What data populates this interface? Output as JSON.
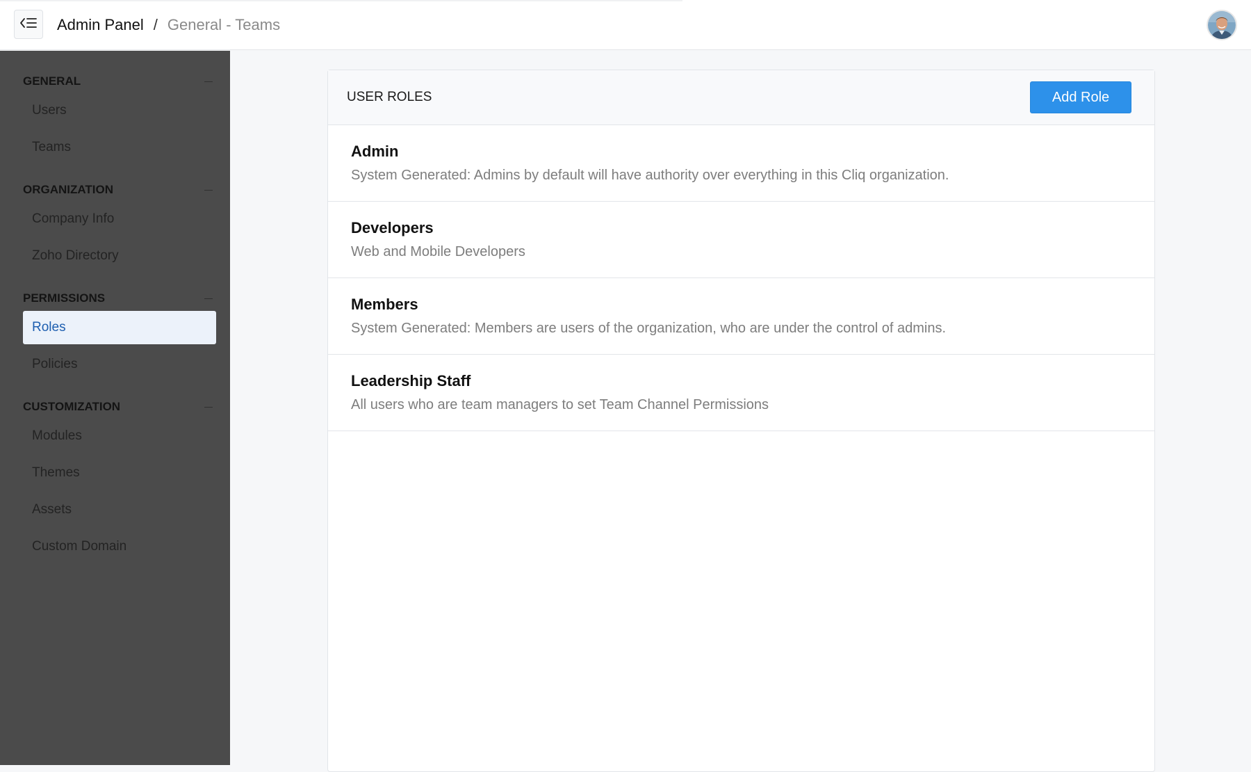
{
  "header": {
    "breadcrumb_root": "Admin Panel",
    "breadcrumb_separator": "/",
    "breadcrumb_current": "General - Teams",
    "toggle_icon": "collapse-menu-icon",
    "avatar_icon": "user-avatar"
  },
  "sidebar": {
    "sections": [
      {
        "title": "GENERAL",
        "items": [
          "Users",
          "Teams"
        ]
      },
      {
        "title": "ORGANIZATION",
        "items": [
          "Company Info",
          "Zoho Directory"
        ]
      },
      {
        "title": "PERMISSIONS",
        "items": [
          "Roles",
          "Policies"
        ]
      },
      {
        "title": "CUSTOMIZATION",
        "items": [
          "Modules",
          "Themes",
          "Assets",
          "Custom Domain"
        ]
      }
    ],
    "active_item": "Roles"
  },
  "panel": {
    "title": "USER ROLES",
    "add_button_label": "Add Role",
    "roles": [
      {
        "name": "Admin",
        "description": "System Generated: Admins by default will have authority over everything in this Cliq organization."
      },
      {
        "name": "Developers",
        "description": "Web and Mobile Developers"
      },
      {
        "name": "Members",
        "description": "System Generated: Members are users of the organization, who are under the control of admins."
      },
      {
        "name": "Leadership Staff",
        "description": "All users who are team managers to set Team Channel Permissions"
      }
    ]
  },
  "colors": {
    "sidebar_bg": "#4b4b4b",
    "active_item_bg": "#ecf2fa",
    "active_item_text": "#1e5fb0",
    "primary_button": "#2d91ea"
  }
}
